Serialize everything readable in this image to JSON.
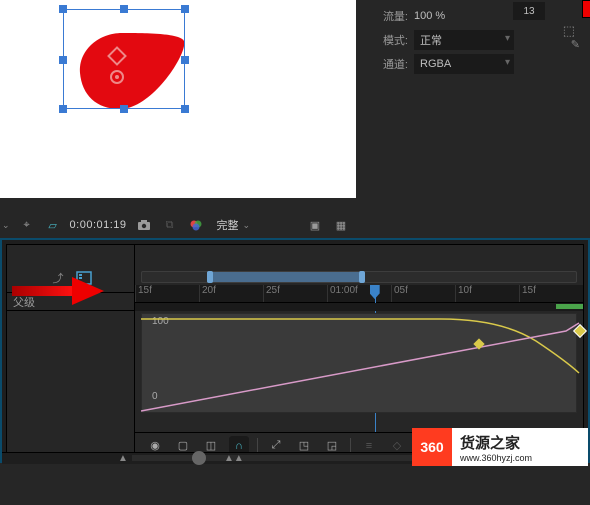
{
  "preview": {
    "shape_fill": "#e30910",
    "selection_color": "#3a7ad3"
  },
  "props": {
    "font_size": "13",
    "flow_label": "流量:",
    "flow_value": "100 %",
    "mode_label": "模式:",
    "mode_value": "正常",
    "channel_label": "通道:",
    "channel_value": "RGBA",
    "fg_color": "#ee0000",
    "bg_color": "#ffffff"
  },
  "preview_toolbar": {
    "timecode": "0:00:01:19",
    "render_label": "完整"
  },
  "timeline": {
    "parent_label": "父级",
    "ruler_ticks": [
      "15f",
      "20f",
      "25f",
      "01:00f",
      "05f",
      "10f",
      "15f"
    ],
    "graph_max_label": "100",
    "graph_min_label": "0",
    "cti_position_pct": 53.5,
    "work_area_start_pct": 15,
    "work_area_end_pct": 50,
    "layer_bar_start_pct": 94,
    "layer_bar_end_pct": 100
  },
  "watermark": {
    "badge": "360",
    "name": "货源之家",
    "url": "www.360hyzj.com"
  },
  "icons": {
    "dropdown": "⌄",
    "target": "⌖",
    "mask": "▱",
    "camera": "📷",
    "link": "⧉",
    "color": "●",
    "grid": "▦",
    "monitor": "▣",
    "shy": "⤴",
    "graph": "☐",
    "eye": "◉",
    "frame": "▢",
    "bounds": "◫",
    "motionblur": "∩",
    "fit": "⤢",
    "clip1": "◳",
    "clip2": "◲",
    "pencil": "✎",
    "transparent": "⬚"
  }
}
